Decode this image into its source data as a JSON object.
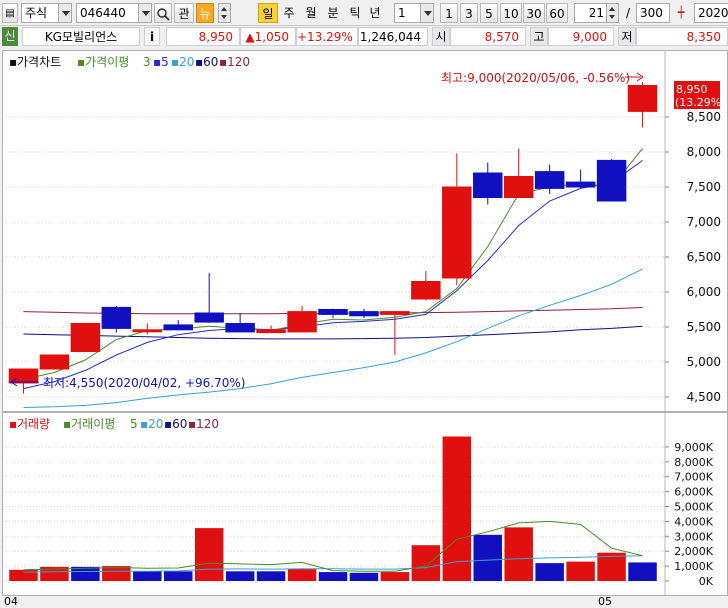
{
  "toolbar": {
    "market_select": "주식",
    "stock_code": "046440",
    "btn_gwan": "관",
    "btn_new": "뉴",
    "btn_il": "일",
    "btn_ju": "주",
    "btn_wol": "월",
    "btn_bun": "분",
    "btn_tick": "틱",
    "btn_nyeon": "년",
    "period_select": "1",
    "period_buttons": [
      "1",
      "3",
      "5",
      "10",
      "30",
      "60"
    ],
    "count_value": "21",
    "count_sep": "/",
    "count_total": "300",
    "date_value": "2020"
  },
  "quote": {
    "badge": "신",
    "name": "KG모빌리언스",
    "info": "i",
    "price": "8,950",
    "change": "▲1,050",
    "change_pct": "+13.29%",
    "volume": "1,246,044",
    "open_label": "시",
    "open": "8,570",
    "high_label": "고",
    "high": "9,000",
    "low_label": "저",
    "low": "8,350"
  },
  "price_panel": {
    "legend_title": "가격차트",
    "legend_ma": "가격이평",
    "legend_ma_periods": [
      "3",
      "5",
      "20",
      "60",
      "120"
    ],
    "legend_colors": [
      "#4a8a2a",
      "#2a2ad0",
      "#3aa0d0",
      "#101080",
      "#902040"
    ],
    "max_note": "최고:9,000(2020/05/06, -0.56%)",
    "min_note": "최저:4,550(2020/04/02, +96.70%)",
    "last_price_tag": "8,950",
    "last_pct_tag": "(13.29%)",
    "y_ticks": [
      "8,500",
      "8,000",
      "7,500",
      "7,000",
      "6,500",
      "6,000",
      "5,500",
      "5,000",
      "4,500"
    ]
  },
  "volume_panel": {
    "legend_title": "거래량",
    "legend_ma": "거래이평",
    "legend_ma_periods": [
      "5",
      "20",
      "60",
      "120"
    ],
    "y_ticks": [
      "9,000K",
      "8,000K",
      "7,000K",
      "6,000K",
      "5,000K",
      "4,000K",
      "3,000K",
      "2,000K",
      "1,000K",
      "0K"
    ]
  },
  "x_axis": {
    "labels": [
      "04",
      "05"
    ]
  },
  "chart_data": {
    "type": "candlestick",
    "up_color": "#e01010",
    "down_color": "#1010c0",
    "ylim": [
      4300,
      9300
    ],
    "volume_ylim": [
      0,
      9800000
    ],
    "candles": [
      {
        "o": 4700,
        "h": 4900,
        "l": 4550,
        "c": 4900
      },
      {
        "o": 4900,
        "h": 5100,
        "l": 4900,
        "c": 5100
      },
      {
        "o": 5150,
        "h": 5550,
        "l": 5150,
        "c": 5550
      },
      {
        "o": 5780,
        "h": 5800,
        "l": 5420,
        "c": 5480
      },
      {
        "o": 5440,
        "h": 5550,
        "l": 5400,
        "c": 5460
      },
      {
        "o": 5530,
        "h": 5600,
        "l": 5460,
        "c": 5460
      },
      {
        "o": 5700,
        "h": 6270,
        "l": 5560,
        "c": 5570
      },
      {
        "o": 5550,
        "h": 5700,
        "l": 5430,
        "c": 5430
      },
      {
        "o": 5420,
        "h": 5520,
        "l": 5420,
        "c": 5460
      },
      {
        "o": 5430,
        "h": 5800,
        "l": 5430,
        "c": 5720
      },
      {
        "o": 5750,
        "h": 5760,
        "l": 5630,
        "c": 5680
      },
      {
        "o": 5720,
        "h": 5760,
        "l": 5630,
        "c": 5660
      },
      {
        "o": 5680,
        "h": 5720,
        "l": 5100,
        "c": 5720
      },
      {
        "o": 5900,
        "h": 6300,
        "l": 5880,
        "c": 6150
      },
      {
        "o": 6200,
        "h": 7980,
        "l": 6100,
        "c": 7500
      },
      {
        "o": 7700,
        "h": 7850,
        "l": 7250,
        "c": 7350
      },
      {
        "o": 7350,
        "h": 8050,
        "l": 7350,
        "c": 7650
      },
      {
        "o": 7720,
        "h": 7820,
        "l": 7400,
        "c": 7480
      },
      {
        "o": 7570,
        "h": 7750,
        "l": 7480,
        "c": 7500
      },
      {
        "o": 7880,
        "h": 7900,
        "l": 7300,
        "c": 7300
      },
      {
        "o": 8580,
        "h": 9000,
        "l": 8350,
        "c": 8950
      }
    ],
    "ma3": [
      4750,
      4850,
      5030,
      5320,
      5450,
      5470,
      5510,
      5480,
      5450,
      5540,
      5610,
      5600,
      5640,
      5720,
      6050,
      6650,
      7400,
      7500,
      7550,
      7500,
      8050
    ],
    "ma5": [
      4620,
      4720,
      4880,
      5100,
      5280,
      5390,
      5450,
      5480,
      5460,
      5500,
      5560,
      5580,
      5610,
      5680,
      6020,
      6450,
      6950,
      7300,
      7480,
      7560,
      7880
    ],
    "ma20": [
      4350,
      4360,
      4380,
      4420,
      4480,
      4530,
      4570,
      4620,
      4690,
      4780,
      4850,
      4920,
      5000,
      5130,
      5290,
      5480,
      5660,
      5810,
      5950,
      6110,
      6330
    ],
    "ma60": [
      5400,
      5390,
      5380,
      5370,
      5360,
      5350,
      5340,
      5335,
      5330,
      5330,
      5330,
      5335,
      5340,
      5350,
      5370,
      5390,
      5410,
      5430,
      5460,
      5480,
      5510
    ],
    "ma120": [
      5720,
      5710,
      5700,
      5695,
      5690,
      5690,
      5690,
      5690,
      5690,
      5695,
      5695,
      5700,
      5700,
      5705,
      5710,
      5720,
      5730,
      5740,
      5750,
      5760,
      5780
    ],
    "volume": [
      750000,
      950000,
      950000,
      1000000,
      650000,
      650000,
      3550000,
      650000,
      650000,
      800000,
      600000,
      550000,
      600000,
      2400000,
      9700000,
      3100000,
      3600000,
      1200000,
      1300000,
      1900000,
      1246044
    ],
    "volume_up": [
      true,
      true,
      false,
      true,
      false,
      false,
      true,
      false,
      false,
      true,
      false,
      false,
      true,
      true,
      true,
      false,
      true,
      false,
      true,
      true,
      false
    ],
    "vma5": [
      750000,
      800000,
      850000,
      900000,
      860000,
      870000,
      1200000,
      1150000,
      1100000,
      1250000,
      700000,
      650000,
      650000,
      1000000,
      2800000,
      3300000,
      3900000,
      4000000,
      3800000,
      2200000,
      1700000
    ],
    "vma20": [
      600000,
      620000,
      640000,
      650000,
      660000,
      680000,
      800000,
      810000,
      800000,
      820000,
      820000,
      800000,
      800000,
      900000,
      1300000,
      1400000,
      1500000,
      1550000,
      1600000,
      1650000,
      1700000
    ]
  }
}
